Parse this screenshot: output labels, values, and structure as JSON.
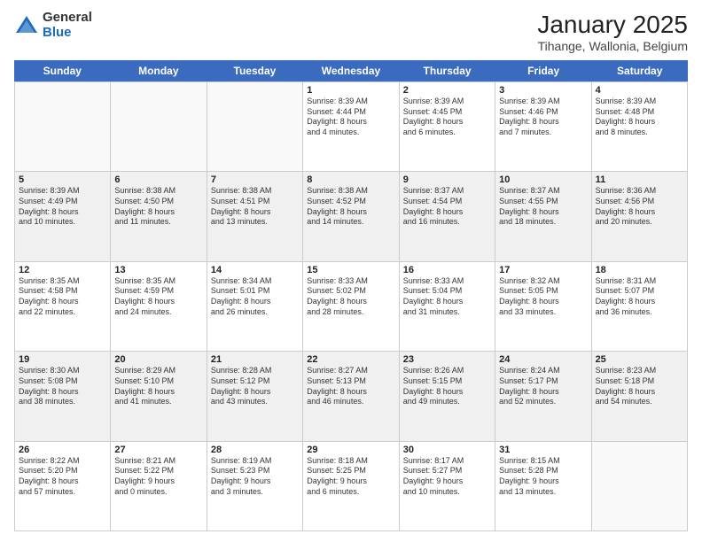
{
  "logo": {
    "general": "General",
    "blue": "Blue"
  },
  "title": "January 2025",
  "location": "Tihange, Wallonia, Belgium",
  "days_of_week": [
    "Sunday",
    "Monday",
    "Tuesday",
    "Wednesday",
    "Thursday",
    "Friday",
    "Saturday"
  ],
  "weeks": [
    [
      {
        "day": "",
        "text": "",
        "empty": true
      },
      {
        "day": "",
        "text": "",
        "empty": true
      },
      {
        "day": "",
        "text": "",
        "empty": true
      },
      {
        "day": "1",
        "text": "Sunrise: 8:39 AM\nSunset: 4:44 PM\nDaylight: 8 hours\nand 4 minutes."
      },
      {
        "day": "2",
        "text": "Sunrise: 8:39 AM\nSunset: 4:45 PM\nDaylight: 8 hours\nand 6 minutes."
      },
      {
        "day": "3",
        "text": "Sunrise: 8:39 AM\nSunset: 4:46 PM\nDaylight: 8 hours\nand 7 minutes."
      },
      {
        "day": "4",
        "text": "Sunrise: 8:39 AM\nSunset: 4:48 PM\nDaylight: 8 hours\nand 8 minutes."
      }
    ],
    [
      {
        "day": "5",
        "text": "Sunrise: 8:39 AM\nSunset: 4:49 PM\nDaylight: 8 hours\nand 10 minutes."
      },
      {
        "day": "6",
        "text": "Sunrise: 8:38 AM\nSunset: 4:50 PM\nDaylight: 8 hours\nand 11 minutes."
      },
      {
        "day": "7",
        "text": "Sunrise: 8:38 AM\nSunset: 4:51 PM\nDaylight: 8 hours\nand 13 minutes."
      },
      {
        "day": "8",
        "text": "Sunrise: 8:38 AM\nSunset: 4:52 PM\nDaylight: 8 hours\nand 14 minutes."
      },
      {
        "day": "9",
        "text": "Sunrise: 8:37 AM\nSunset: 4:54 PM\nDaylight: 8 hours\nand 16 minutes."
      },
      {
        "day": "10",
        "text": "Sunrise: 8:37 AM\nSunset: 4:55 PM\nDaylight: 8 hours\nand 18 minutes."
      },
      {
        "day": "11",
        "text": "Sunrise: 8:36 AM\nSunset: 4:56 PM\nDaylight: 8 hours\nand 20 minutes."
      }
    ],
    [
      {
        "day": "12",
        "text": "Sunrise: 8:35 AM\nSunset: 4:58 PM\nDaylight: 8 hours\nand 22 minutes."
      },
      {
        "day": "13",
        "text": "Sunrise: 8:35 AM\nSunset: 4:59 PM\nDaylight: 8 hours\nand 24 minutes."
      },
      {
        "day": "14",
        "text": "Sunrise: 8:34 AM\nSunset: 5:01 PM\nDaylight: 8 hours\nand 26 minutes."
      },
      {
        "day": "15",
        "text": "Sunrise: 8:33 AM\nSunset: 5:02 PM\nDaylight: 8 hours\nand 28 minutes."
      },
      {
        "day": "16",
        "text": "Sunrise: 8:33 AM\nSunset: 5:04 PM\nDaylight: 8 hours\nand 31 minutes."
      },
      {
        "day": "17",
        "text": "Sunrise: 8:32 AM\nSunset: 5:05 PM\nDaylight: 8 hours\nand 33 minutes."
      },
      {
        "day": "18",
        "text": "Sunrise: 8:31 AM\nSunset: 5:07 PM\nDaylight: 8 hours\nand 36 minutes."
      }
    ],
    [
      {
        "day": "19",
        "text": "Sunrise: 8:30 AM\nSunset: 5:08 PM\nDaylight: 8 hours\nand 38 minutes."
      },
      {
        "day": "20",
        "text": "Sunrise: 8:29 AM\nSunset: 5:10 PM\nDaylight: 8 hours\nand 41 minutes."
      },
      {
        "day": "21",
        "text": "Sunrise: 8:28 AM\nSunset: 5:12 PM\nDaylight: 8 hours\nand 43 minutes."
      },
      {
        "day": "22",
        "text": "Sunrise: 8:27 AM\nSunset: 5:13 PM\nDaylight: 8 hours\nand 46 minutes."
      },
      {
        "day": "23",
        "text": "Sunrise: 8:26 AM\nSunset: 5:15 PM\nDaylight: 8 hours\nand 49 minutes."
      },
      {
        "day": "24",
        "text": "Sunrise: 8:24 AM\nSunset: 5:17 PM\nDaylight: 8 hours\nand 52 minutes."
      },
      {
        "day": "25",
        "text": "Sunrise: 8:23 AM\nSunset: 5:18 PM\nDaylight: 8 hours\nand 54 minutes."
      }
    ],
    [
      {
        "day": "26",
        "text": "Sunrise: 8:22 AM\nSunset: 5:20 PM\nDaylight: 8 hours\nand 57 minutes."
      },
      {
        "day": "27",
        "text": "Sunrise: 8:21 AM\nSunset: 5:22 PM\nDaylight: 9 hours\nand 0 minutes."
      },
      {
        "day": "28",
        "text": "Sunrise: 8:19 AM\nSunset: 5:23 PM\nDaylight: 9 hours\nand 3 minutes."
      },
      {
        "day": "29",
        "text": "Sunrise: 8:18 AM\nSunset: 5:25 PM\nDaylight: 9 hours\nand 6 minutes."
      },
      {
        "day": "30",
        "text": "Sunrise: 8:17 AM\nSunset: 5:27 PM\nDaylight: 9 hours\nand 10 minutes."
      },
      {
        "day": "31",
        "text": "Sunrise: 8:15 AM\nSunset: 5:28 PM\nDaylight: 9 hours\nand 13 minutes."
      },
      {
        "day": "",
        "text": "",
        "empty": true
      }
    ]
  ]
}
